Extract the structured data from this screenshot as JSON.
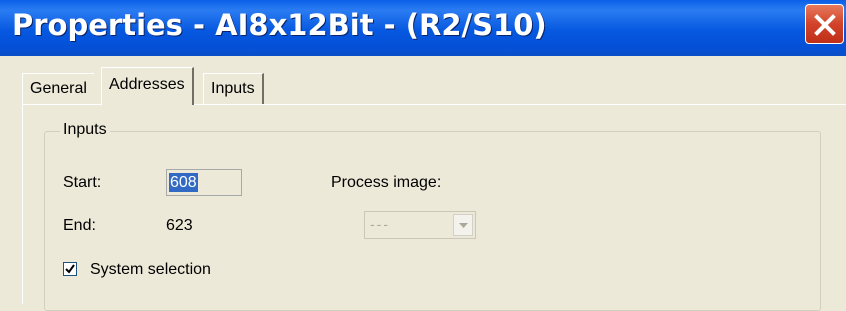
{
  "window": {
    "title": "Properties - AI8x12Bit - (R2/S10)",
    "close_icon": "close-icon"
  },
  "tabs": [
    {
      "label": "General",
      "active": false
    },
    {
      "label": "Addresses",
      "active": true
    },
    {
      "label": "Inputs",
      "active": false
    }
  ],
  "inputs_group": {
    "label": "Inputs",
    "start_label": "Start:",
    "start_value": "608",
    "end_label": "End:",
    "end_value": "623",
    "process_image_label": "Process image:",
    "process_image_value": "---",
    "system_selection_label": "System selection",
    "system_selection_checked": true
  },
  "colors": {
    "titlebar": "#0658e0",
    "close_button": "#d1432a",
    "dialog_bg": "#ece9d8",
    "selection": "#316ac5"
  }
}
